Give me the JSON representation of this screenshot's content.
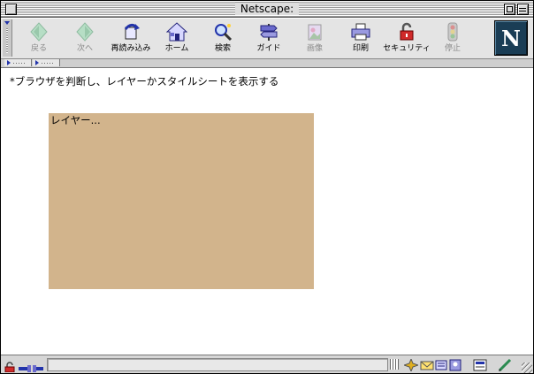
{
  "window": {
    "title": "Netscape:"
  },
  "toolbar": {
    "buttons": [
      {
        "id": "back",
        "label": "戻る",
        "icon": "back-arrow-icon",
        "enabled": false
      },
      {
        "id": "forward",
        "label": "次へ",
        "icon": "forward-arrow-icon",
        "enabled": false
      },
      {
        "id": "reload",
        "label": "再読み込み",
        "icon": "reload-icon",
        "enabled": true
      },
      {
        "id": "home",
        "label": "ホーム",
        "icon": "home-icon",
        "enabled": true
      },
      {
        "id": "search",
        "label": "検索",
        "icon": "search-icon",
        "enabled": true
      },
      {
        "id": "guide",
        "label": "ガイド",
        "icon": "guide-icon",
        "enabled": true
      },
      {
        "id": "images",
        "label": "画像",
        "icon": "images-icon",
        "enabled": false
      },
      {
        "id": "print",
        "label": "印刷",
        "icon": "print-icon",
        "enabled": true
      },
      {
        "id": "security",
        "label": "セキュリティ",
        "icon": "lock-icon",
        "enabled": true
      },
      {
        "id": "stop",
        "label": "停止",
        "icon": "stop-icon",
        "enabled": false
      }
    ],
    "logo_letter": "N"
  },
  "content": {
    "heading": "*ブラウザを判断し、レイヤーかスタイルシートを表示する",
    "layer": {
      "text": "レイヤー...",
      "background": "#d2b48c"
    }
  },
  "colors": {
    "layer_bg": "#d2b48c",
    "logo_bg": "#1a3d55"
  }
}
